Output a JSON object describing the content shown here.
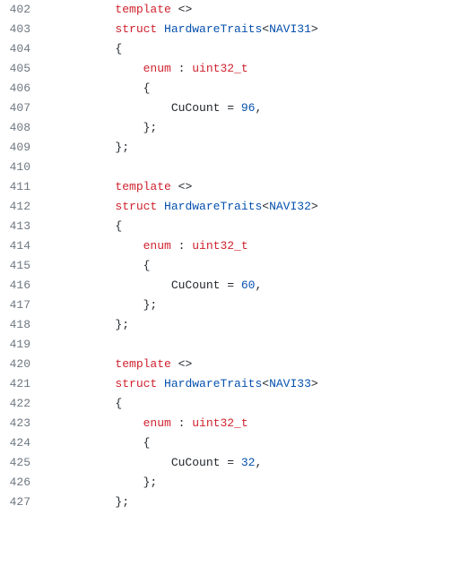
{
  "lines": [
    {
      "num": "402",
      "tokens": [
        {
          "t": "indent",
          "v": "        "
        },
        {
          "t": "kw",
          "v": "template"
        },
        {
          "t": "op",
          "v": " <>"
        }
      ]
    },
    {
      "num": "403",
      "tokens": [
        {
          "t": "indent",
          "v": "        "
        },
        {
          "t": "kw",
          "v": "struct"
        },
        {
          "t": "plain",
          "v": " "
        },
        {
          "t": "struct-name",
          "v": "HardwareTraits"
        },
        {
          "t": "op",
          "v": "<"
        },
        {
          "t": "tmpl-arg",
          "v": "NAVI31"
        },
        {
          "t": "op",
          "v": ">"
        }
      ]
    },
    {
      "num": "404",
      "tokens": [
        {
          "t": "indent",
          "v": "        "
        },
        {
          "t": "op",
          "v": "{"
        }
      ]
    },
    {
      "num": "405",
      "tokens": [
        {
          "t": "indent",
          "v": "            "
        },
        {
          "t": "kw",
          "v": "enum"
        },
        {
          "t": "plain",
          "v": " : "
        },
        {
          "t": "type",
          "v": "uint32_t"
        }
      ]
    },
    {
      "num": "406",
      "tokens": [
        {
          "t": "indent",
          "v": "            "
        },
        {
          "t": "op",
          "v": "{"
        }
      ]
    },
    {
      "num": "407",
      "tokens": [
        {
          "t": "indent",
          "v": "                "
        },
        {
          "t": "ident",
          "v": "CuCount = "
        },
        {
          "t": "num",
          "v": "96"
        },
        {
          "t": "op",
          "v": ","
        }
      ]
    },
    {
      "num": "408",
      "tokens": [
        {
          "t": "indent",
          "v": "            "
        },
        {
          "t": "op",
          "v": "};"
        }
      ]
    },
    {
      "num": "409",
      "tokens": [
        {
          "t": "indent",
          "v": "        "
        },
        {
          "t": "op",
          "v": "};"
        }
      ]
    },
    {
      "num": "410",
      "tokens": []
    },
    {
      "num": "411",
      "tokens": [
        {
          "t": "indent",
          "v": "        "
        },
        {
          "t": "kw",
          "v": "template"
        },
        {
          "t": "op",
          "v": " <>"
        }
      ]
    },
    {
      "num": "412",
      "tokens": [
        {
          "t": "indent",
          "v": "        "
        },
        {
          "t": "kw",
          "v": "struct"
        },
        {
          "t": "plain",
          "v": " "
        },
        {
          "t": "struct-name",
          "v": "HardwareTraits"
        },
        {
          "t": "op",
          "v": "<"
        },
        {
          "t": "tmpl-arg",
          "v": "NAVI32"
        },
        {
          "t": "op",
          "v": ">"
        }
      ]
    },
    {
      "num": "413",
      "tokens": [
        {
          "t": "indent",
          "v": "        "
        },
        {
          "t": "op",
          "v": "{"
        }
      ]
    },
    {
      "num": "414",
      "tokens": [
        {
          "t": "indent",
          "v": "            "
        },
        {
          "t": "kw",
          "v": "enum"
        },
        {
          "t": "plain",
          "v": " : "
        },
        {
          "t": "type",
          "v": "uint32_t"
        }
      ]
    },
    {
      "num": "415",
      "tokens": [
        {
          "t": "indent",
          "v": "            "
        },
        {
          "t": "op",
          "v": "{"
        }
      ]
    },
    {
      "num": "416",
      "tokens": [
        {
          "t": "indent",
          "v": "                "
        },
        {
          "t": "ident",
          "v": "CuCount = "
        },
        {
          "t": "num",
          "v": "60"
        },
        {
          "t": "op",
          "v": ","
        }
      ]
    },
    {
      "num": "417",
      "tokens": [
        {
          "t": "indent",
          "v": "            "
        },
        {
          "t": "op",
          "v": "};"
        }
      ]
    },
    {
      "num": "418",
      "tokens": [
        {
          "t": "indent",
          "v": "        "
        },
        {
          "t": "op",
          "v": "};"
        }
      ]
    },
    {
      "num": "419",
      "tokens": []
    },
    {
      "num": "420",
      "tokens": [
        {
          "t": "indent",
          "v": "        "
        },
        {
          "t": "kw",
          "v": "template"
        },
        {
          "t": "op",
          "v": " <>"
        }
      ]
    },
    {
      "num": "421",
      "tokens": [
        {
          "t": "indent",
          "v": "        "
        },
        {
          "t": "kw",
          "v": "struct"
        },
        {
          "t": "plain",
          "v": " "
        },
        {
          "t": "struct-name",
          "v": "HardwareTraits"
        },
        {
          "t": "op",
          "v": "<"
        },
        {
          "t": "tmpl-arg",
          "v": "NAVI33"
        },
        {
          "t": "op",
          "v": ">"
        }
      ]
    },
    {
      "num": "422",
      "tokens": [
        {
          "t": "indent",
          "v": "        "
        },
        {
          "t": "op",
          "v": "{"
        }
      ]
    },
    {
      "num": "423",
      "tokens": [
        {
          "t": "indent",
          "v": "            "
        },
        {
          "t": "kw",
          "v": "enum"
        },
        {
          "t": "plain",
          "v": " : "
        },
        {
          "t": "type",
          "v": "uint32_t"
        }
      ]
    },
    {
      "num": "424",
      "tokens": [
        {
          "t": "indent",
          "v": "            "
        },
        {
          "t": "op",
          "v": "{"
        }
      ]
    },
    {
      "num": "425",
      "tokens": [
        {
          "t": "indent",
          "v": "                "
        },
        {
          "t": "ident",
          "v": "CuCount = "
        },
        {
          "t": "num",
          "v": "32"
        },
        {
          "t": "op",
          "v": ","
        }
      ]
    },
    {
      "num": "426",
      "tokens": [
        {
          "t": "indent",
          "v": "            "
        },
        {
          "t": "op",
          "v": "};"
        }
      ]
    },
    {
      "num": "427",
      "tokens": [
        {
          "t": "indent",
          "v": "        "
        },
        {
          "t": "op",
          "v": "};"
        }
      ]
    }
  ]
}
